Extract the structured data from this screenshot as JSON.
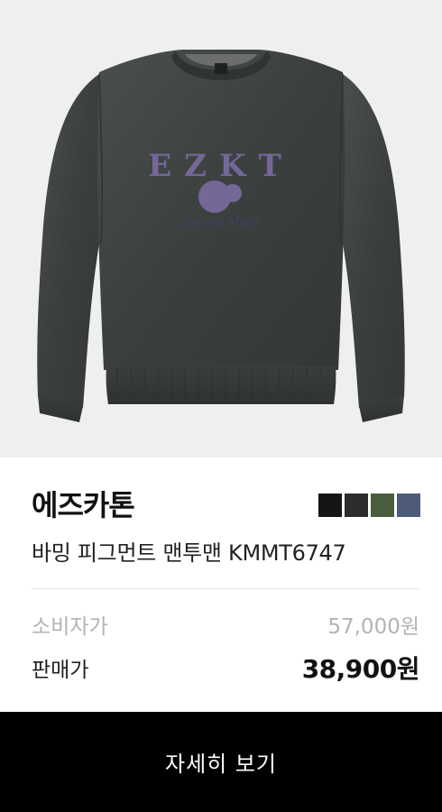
{
  "brand": "에즈카톤",
  "product_name": "바밍 피그먼트 맨투맨 KMMT6747",
  "image": {
    "alt": "product-image",
    "background": "#efefef",
    "garment_color": "#3f4342",
    "print_color": "#7d6fa8"
  },
  "color_options": [
    {
      "name": "black",
      "hex": "#151515"
    },
    {
      "name": "charcoal",
      "hex": "#2b2c2e"
    },
    {
      "name": "khaki",
      "hex": "#4a5d3d"
    },
    {
      "name": "navy",
      "hex": "#4d5b78"
    }
  ],
  "prices": {
    "retail_label": "소비자가",
    "retail_value": "57,000원",
    "sale_label": "판매가",
    "sale_value": "38,900원"
  },
  "cta": {
    "label": "자세히 보기"
  }
}
